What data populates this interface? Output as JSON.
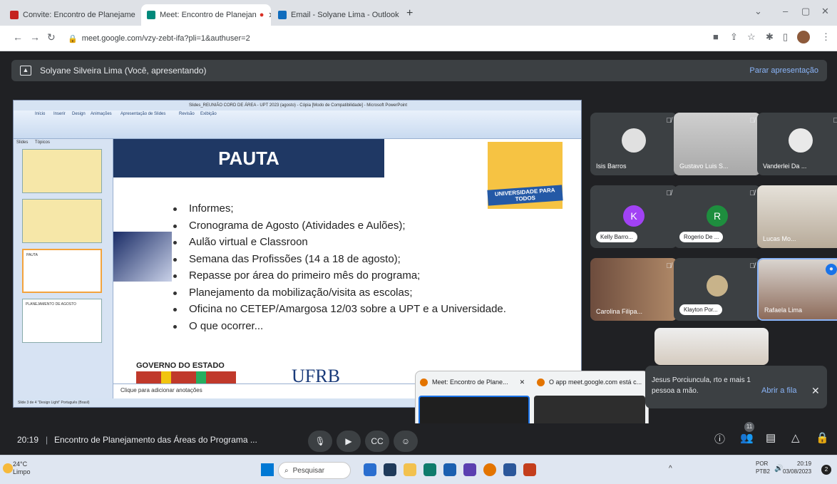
{
  "browser": {
    "tabs": [
      {
        "label": "Convite: Encontro de Planejame",
        "color": "#c5221f"
      },
      {
        "label": "Meet: Encontro de Planejan",
        "color": "#00897b"
      },
      {
        "label": "Email - Solyane Lima - Outlook",
        "color": "#0f6cbd"
      }
    ],
    "new_tab": "+",
    "url": "meet.google.com/vzy-zebt-ifa?pli=1&authuser=2"
  },
  "presenting": {
    "label": "Solyane Silveira Lima (Você, apresentando)",
    "stop": "Parar apresentação"
  },
  "ppt": {
    "title": "Slides_REUNIÃO CORD DE ÁREA - UPT 2023 (agosto) - Cópia [Modo de Compatibilidade] - Microsoft PowerPoint",
    "ribbon_tabs": [
      "Início",
      "Inserir",
      "Design",
      "Animações",
      "Apresentação de Slides",
      "Revisão",
      "Exibição"
    ],
    "panel_tabs": [
      "Slides",
      "Tópicos"
    ],
    "thumbs": [
      "PAUTA",
      "PLANEJAMENTO DE AGOSTO"
    ],
    "slide": {
      "heading": "PAUTA",
      "logo": "UNIVERSIDADE PARA TODOS",
      "bullets": [
        "Informes;",
        "Cronograma de Agosto (Atividades e Aulões);",
        "Aulão virtual e Classroon",
        "Semana das Profissões (14 a 18 de agosto);",
        "Repasse por área do primeiro mês do programa;",
        "Planejamento da mobilização/visita as escolas;",
        "Oficina no CETEP/Amargosa 12/03 sobre a UPT e a Universidade.",
        "O que ocorrer..."
      ],
      "gov": "GOVERNO DO ESTADO",
      "ufrb": "UFRB"
    },
    "notes": "Clique para adicionar anotações",
    "status": "Slide 3 de 4   \"Design Light\"   Português (Brasil)"
  },
  "participants": [
    {
      "name": "Isis Barros"
    },
    {
      "name": "Gustavo Luis S..."
    },
    {
      "name": "Vanderlei Da ..."
    },
    {
      "name": "Kelly Barro...",
      "initial": "K",
      "color": "#a142f4"
    },
    {
      "name": "Rogerio De ...",
      "initial": "R",
      "color": "#1e8e3e"
    },
    {
      "name": "Lucas Mo..."
    },
    {
      "name": "Carolina Filipa..."
    },
    {
      "name": "Klayton Por..."
    },
    {
      "name": "Rafaela Lima"
    }
  ],
  "popup": {
    "tab1": "Meet: Encontro de Plane...",
    "tab2": "O app meet.google.com está c..."
  },
  "queue": {
    "text": "Jesus Porciuncula, rto e mais 1 pessoa a mão.",
    "open": "Abrir a fila"
  },
  "bottom": {
    "time": "20:19",
    "meeting": "Encontro de Planejamento das Áreas do Programa ...",
    "people_count": "11"
  },
  "taskbar": {
    "temp": "24°C",
    "condition": "Limpo",
    "search": "Pesquisar",
    "lang1": "POR",
    "lang2": "PTB2",
    "clock_time": "20:19",
    "clock_date": "03/08/2023"
  }
}
